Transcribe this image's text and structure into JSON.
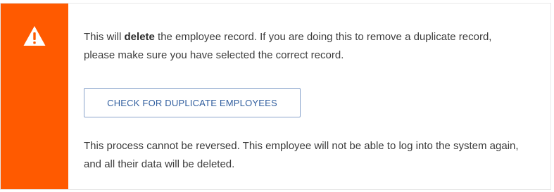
{
  "alert": {
    "icon": "warning-triangle-icon",
    "accent_color": "#ff5a00",
    "message_1": {
      "prefix": "This will ",
      "emphasis": "delete",
      "suffix": " the employee record. If you are doing this to remove a duplicate record, please make sure you have selected the correct record."
    },
    "check_duplicates_label": "CHECK FOR DUPLICATE EMPLOYEES",
    "message_2": "This process cannot be reversed. This employee will not be able to log into the system again, and all their data will be deleted."
  }
}
